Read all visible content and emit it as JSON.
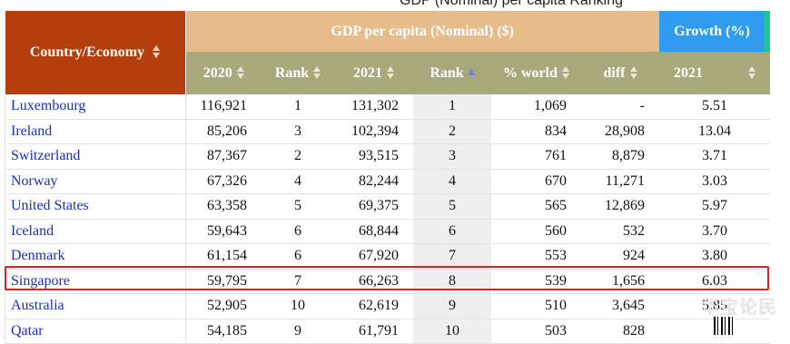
{
  "page_title": "GDP (Nominal) per capita Ranking",
  "headers": {
    "country": "Country/Economy",
    "gdp_group": "GDP per capita (Nominal) ($)",
    "growth_group": "Growth (%)",
    "sub": [
      "2020",
      "Rank",
      "2021",
      "Rank",
      "% world",
      "diff",
      "2021"
    ]
  },
  "rows": [
    {
      "country": "Luxembourg",
      "gdp2020": "116,921",
      "rank2020": "1",
      "gdp2021": "131,302",
      "rank2021": "1",
      "pct_world": "1,069",
      "diff": "-",
      "growth2021": "5.51"
    },
    {
      "country": "Ireland",
      "gdp2020": "85,206",
      "rank2020": "3",
      "gdp2021": "102,394",
      "rank2021": "2",
      "pct_world": "834",
      "diff": "28,908",
      "growth2021": "13.04"
    },
    {
      "country": "Switzerland",
      "gdp2020": "87,367",
      "rank2020": "2",
      "gdp2021": "93,515",
      "rank2021": "3",
      "pct_world": "761",
      "diff": "8,879",
      "growth2021": "3.71"
    },
    {
      "country": "Norway",
      "gdp2020": "67,326",
      "rank2020": "4",
      "gdp2021": "82,244",
      "rank2021": "4",
      "pct_world": "670",
      "diff": "11,271",
      "growth2021": "3.03"
    },
    {
      "country": "United States",
      "gdp2020": "63,358",
      "rank2020": "5",
      "gdp2021": "69,375",
      "rank2021": "5",
      "pct_world": "565",
      "diff": "12,869",
      "growth2021": "5.97"
    },
    {
      "country": "Iceland",
      "gdp2020": "59,643",
      "rank2020": "6",
      "gdp2021": "68,844",
      "rank2021": "6",
      "pct_world": "560",
      "diff": "532",
      "growth2021": "3.70"
    },
    {
      "country": "Denmark",
      "gdp2020": "61,154",
      "rank2020": "6",
      "gdp2021": "67,920",
      "rank2021": "7",
      "pct_world": "553",
      "diff": "924",
      "growth2021": "3.80"
    },
    {
      "country": "Singapore",
      "gdp2020": "59,795",
      "rank2020": "7",
      "gdp2021": "66,263",
      "rank2021": "8",
      "pct_world": "539",
      "diff": "1,656",
      "growth2021": "6.03"
    },
    {
      "country": "Australia",
      "gdp2020": "52,905",
      "rank2020": "10",
      "gdp2021": "62,619",
      "rank2021": "9",
      "pct_world": "510",
      "diff": "3,645",
      "growth2021": "5.85"
    },
    {
      "country": "Qatar",
      "gdp2020": "54,185",
      "rank2020": "9",
      "gdp2021": "61,791",
      "rank2021": "10",
      "pct_world": "503",
      "diff": "828",
      "growth2021": ""
    }
  ],
  "highlighted_country": "Singapore",
  "watermark": "华宝论民",
  "colors": {
    "country_header": "#b53f0c",
    "gdp_header": "#e5bc8a",
    "growth_header": "#2f9cf0",
    "subheader": "#a7a97a",
    "link": "#1a2fb5",
    "highlight_border": "#e02020"
  }
}
